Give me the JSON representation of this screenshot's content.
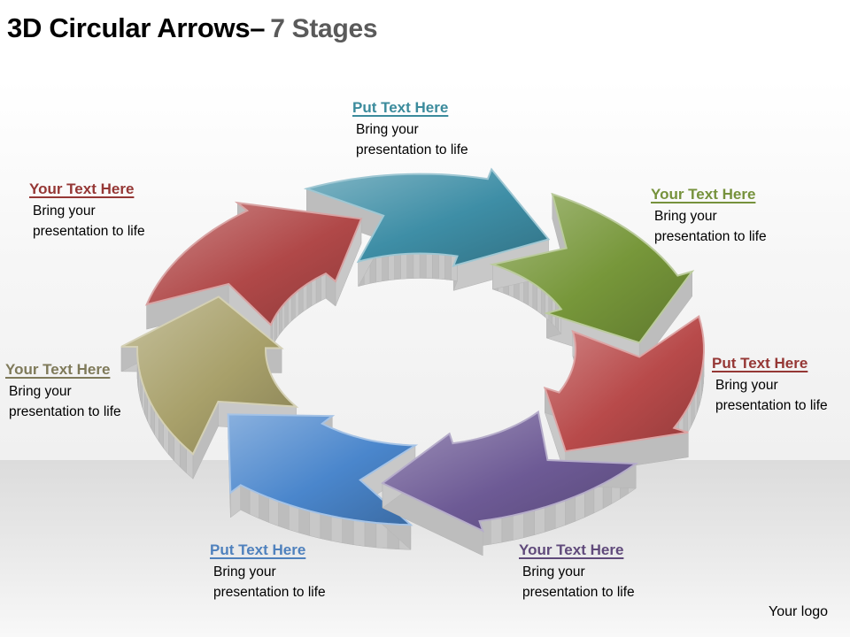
{
  "title": {
    "main": "3D Circular Arrows",
    "dash": "–",
    "sub": "7 Stages"
  },
  "stages": [
    {
      "heading": "Put Text Here",
      "line1": "Bring your",
      "line2": "presentation to life",
      "color": "#3e8ea6",
      "heading_color": "#3b8b9c"
    },
    {
      "heading": "Your Text Here",
      "line1": "Bring your",
      "line2": "presentation to life",
      "color": "#77973a",
      "heading_color": "#76923c"
    },
    {
      "heading": "Put Text Here",
      "line1": "Bring your",
      "line2": "presentation to life",
      "color": "#b84a4a",
      "heading_color": "#953735"
    },
    {
      "heading": "Your Text Here",
      "line1": "Bring your",
      "line2": "presentation to life",
      "color": "#6d5a95",
      "heading_color": "#604a7b"
    },
    {
      "heading": "Put Text Here",
      "line1": "Bring your",
      "line2": "presentation to life",
      "color": "#4a86cc",
      "heading_color": "#4f81bd"
    },
    {
      "heading": "Your Text Here",
      "line1": "Bring your",
      "line2": "presentation to life",
      "color": "#a8a06a",
      "heading_color": "#7f7a5a"
    },
    {
      "heading": "Your Text Here",
      "line1": "Bring your",
      "line2": "presentation to life",
      "color": "#b04848",
      "heading_color": "#953735"
    }
  ],
  "logo": "Your logo"
}
